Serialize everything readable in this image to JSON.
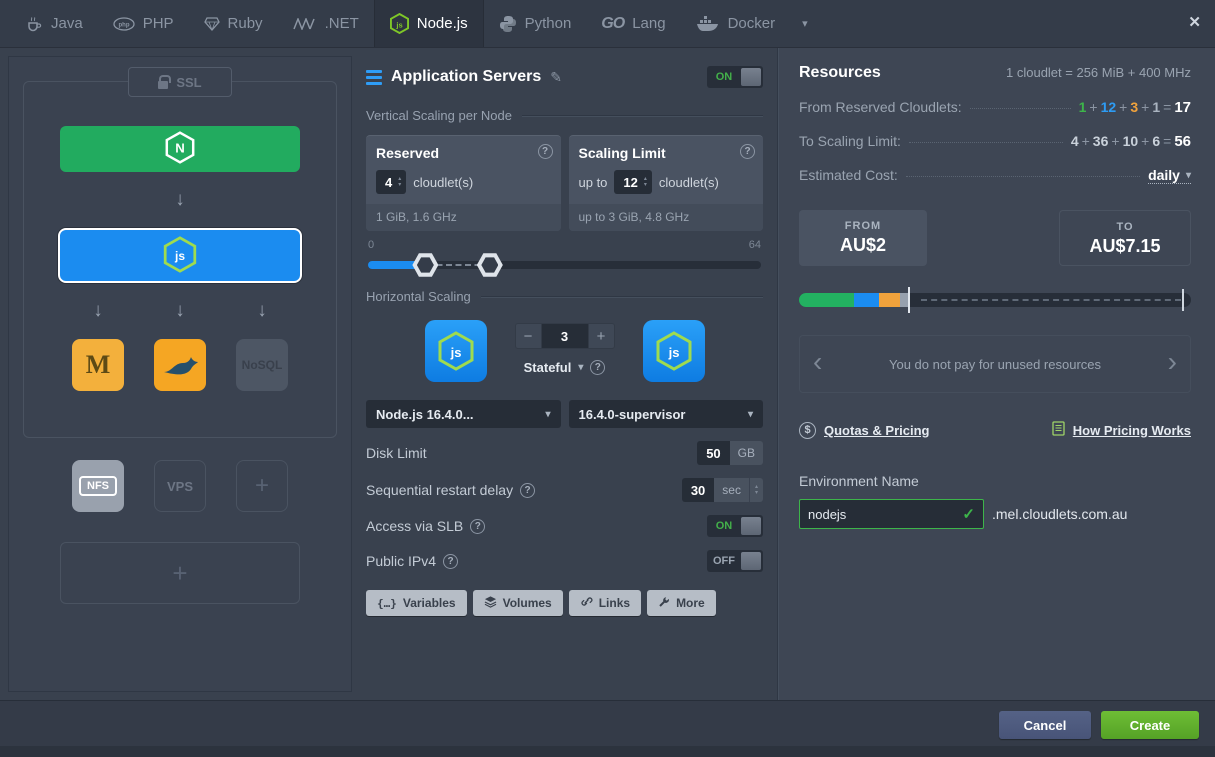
{
  "ui": {
    "close": "✕",
    "caret": "▾",
    "help": "?",
    "pencil": "✎",
    "check": "✓",
    "chevron_left": "‹",
    "chevron_right": "›",
    "minus": "−",
    "plus": "+",
    "equals": "=",
    "arrow_down": "↓",
    "dollar": "$",
    "braces": "{…}",
    "up": "▴",
    "down": "▾"
  },
  "tabs": [
    {
      "label": "Java"
    },
    {
      "label": "PHP"
    },
    {
      "label": "Ruby"
    },
    {
      "label": ".NET"
    },
    {
      "label": "Node.js"
    },
    {
      "label": "Python"
    },
    {
      "label": "Lang",
      "logo_text": "GO"
    },
    {
      "label": "Docker"
    }
  ],
  "topology": {
    "ssl": "SSL",
    "nginx_letter": "N",
    "node_letters": "js",
    "mariadb_letter": "M",
    "nosql": "NoSQL",
    "nfs": "NFS",
    "vps": "VPS",
    "add": "+"
  },
  "app_servers": {
    "title": "Application Servers",
    "toggle": "ON",
    "vertical_title": "Vertical Scaling per Node",
    "reserved": {
      "title": "Reserved",
      "value": "4",
      "unit": "cloudlet(s)",
      "footnote": "1 GiB, 1.6 GHz"
    },
    "limit": {
      "title": "Scaling Limit",
      "prefix": "up to",
      "value": "12",
      "unit": "cloudlet(s)",
      "footnote": "up to 3 GiB, 4.8 GHz"
    },
    "slider_min": "0",
    "slider_max": "64",
    "horizontal_title": "Horizontal Scaling",
    "count": "3",
    "mode": "Stateful",
    "version": "Node.js 16.4.0...",
    "engine": "16.4.0-supervisor",
    "disk": {
      "label": "Disk Limit",
      "value": "50",
      "unit": "GB"
    },
    "restart": {
      "label": "Sequential restart delay",
      "value": "30",
      "unit": "sec"
    },
    "slb": {
      "label": "Access via SLB",
      "toggle": "ON"
    },
    "ipv4": {
      "label": "Public IPv4",
      "toggle": "OFF"
    },
    "buttons": {
      "variables": "Variables",
      "volumes": "Volumes",
      "links": "Links",
      "more": "More"
    }
  },
  "resources": {
    "title": "Resources",
    "formula": "1 cloudlet = 256 MiB + 400 MHz",
    "reserved_row": {
      "label": "From Reserved Cloudlets:",
      "v1": "1",
      "v2": "12",
      "v3": "3",
      "v4": "1",
      "total": "17"
    },
    "limit_row": {
      "label": "To Scaling Limit:",
      "v1": "4",
      "v2": "36",
      "v3": "10",
      "v4": "6",
      "total": "56"
    },
    "cost_label": "Estimated Cost:",
    "cost_period": "daily",
    "from_label": "FROM",
    "from_value": "AU$2",
    "to_label": "TO",
    "to_value": "AU$7.15",
    "note": "You do not pay for unused resources",
    "quotas_link": "Quotas & Pricing",
    "pricing_link": "How Pricing Works"
  },
  "environment": {
    "label": "Environment Name",
    "name": "nodejs",
    "domain": ".mel.cloudlets.com.au"
  },
  "footer": {
    "cancel": "Cancel",
    "create": "Create"
  },
  "colors": {
    "accent_green": "#3db54a",
    "accent_blue": "#2d9cf4",
    "accent_orange": "#f0a23c",
    "nginx_green": "#22ab5f",
    "node_blue": "#1b8cf0",
    "create_button": "#61b234"
  }
}
